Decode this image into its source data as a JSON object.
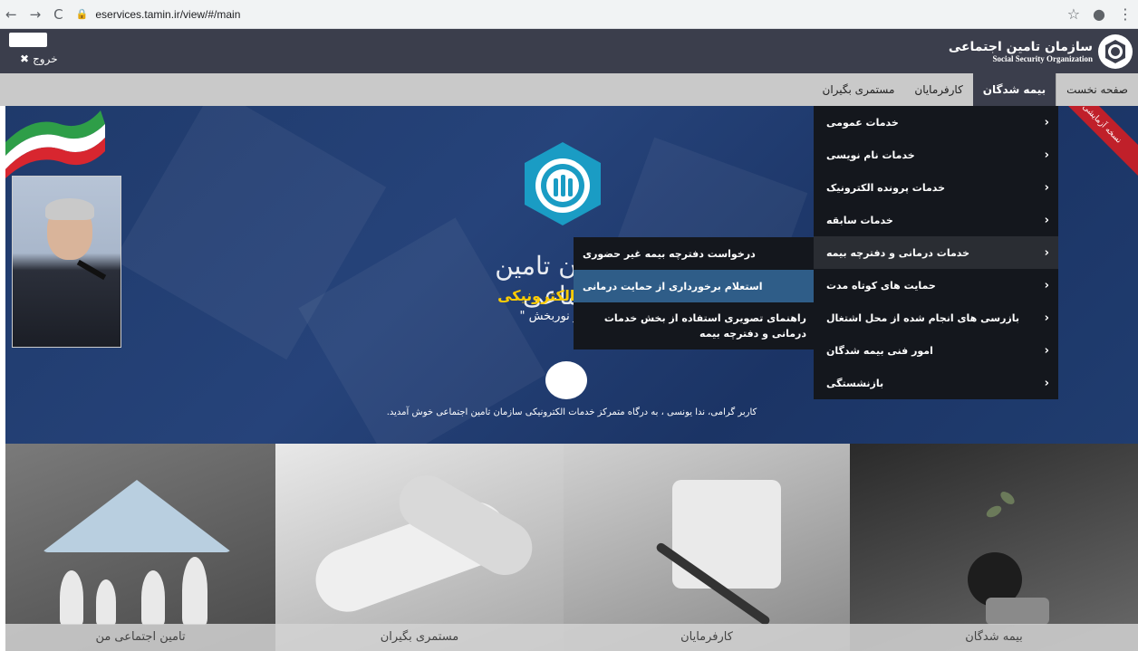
{
  "browser": {
    "url": "eservices.tamin.ir/view/#/main",
    "back": "←",
    "forward": "→",
    "reload": "C",
    "star": "☆",
    "profile": "●",
    "more": "⋮"
  },
  "header": {
    "exit_label": "خروج",
    "logo_fa": "سازمان تامین اجتماعی",
    "logo_en": "Social Security Organization"
  },
  "nav": {
    "tabs": [
      "صفحه نخست",
      "بیمه شدگان",
      "کارفرمایان",
      "مستمری بگیران"
    ],
    "active_index": 1
  },
  "menu": {
    "items": [
      "خدمات عمومی",
      "خدمات نام نویسی",
      "خدمات پرونده الکترونیک",
      "خدمات سابقه",
      "خدمات درمانی و دفترچه بیمه",
      "حمایت های کوتاه مدت",
      "بازرسی های انجام شده از محل اشتغال",
      "امور فنی بیمه شدگان",
      "بازنشستگی"
    ],
    "active_index": 4
  },
  "submenu": {
    "items": [
      "درخواست دفترچه بیمه غیر حضوری",
      "استعلام برخورداری از حمایت درمانی",
      "راهنمای تصویری استفاده از بخش خدمات درمانی و دفترچه بیمه"
    ],
    "highlight_index": 1
  },
  "hero": {
    "title": "سازمان تامین اجتماعی",
    "subtitle": "ت الکترونیکی",
    "author": "دکتر نوربخش \"",
    "ribbon": "نسخه آزمایشی",
    "welcome": "کاربر گرامی، ندا یونسی ، به درگاه متمرکز خدمات الکترونیکی سازمان تامین اجتماعی خوش آمدید."
  },
  "tiles": [
    "تامین اجتماعی من",
    "مستمری بگیران",
    "کارفرمایان",
    "بیمه شدگان"
  ],
  "colors": {
    "header_bg": "#3b3e4c",
    "nav_bg": "#c9c9c9",
    "menu_bg": "#14171d",
    "highlight": "#2f5d88",
    "brand_teal": "#1a9cc4"
  }
}
